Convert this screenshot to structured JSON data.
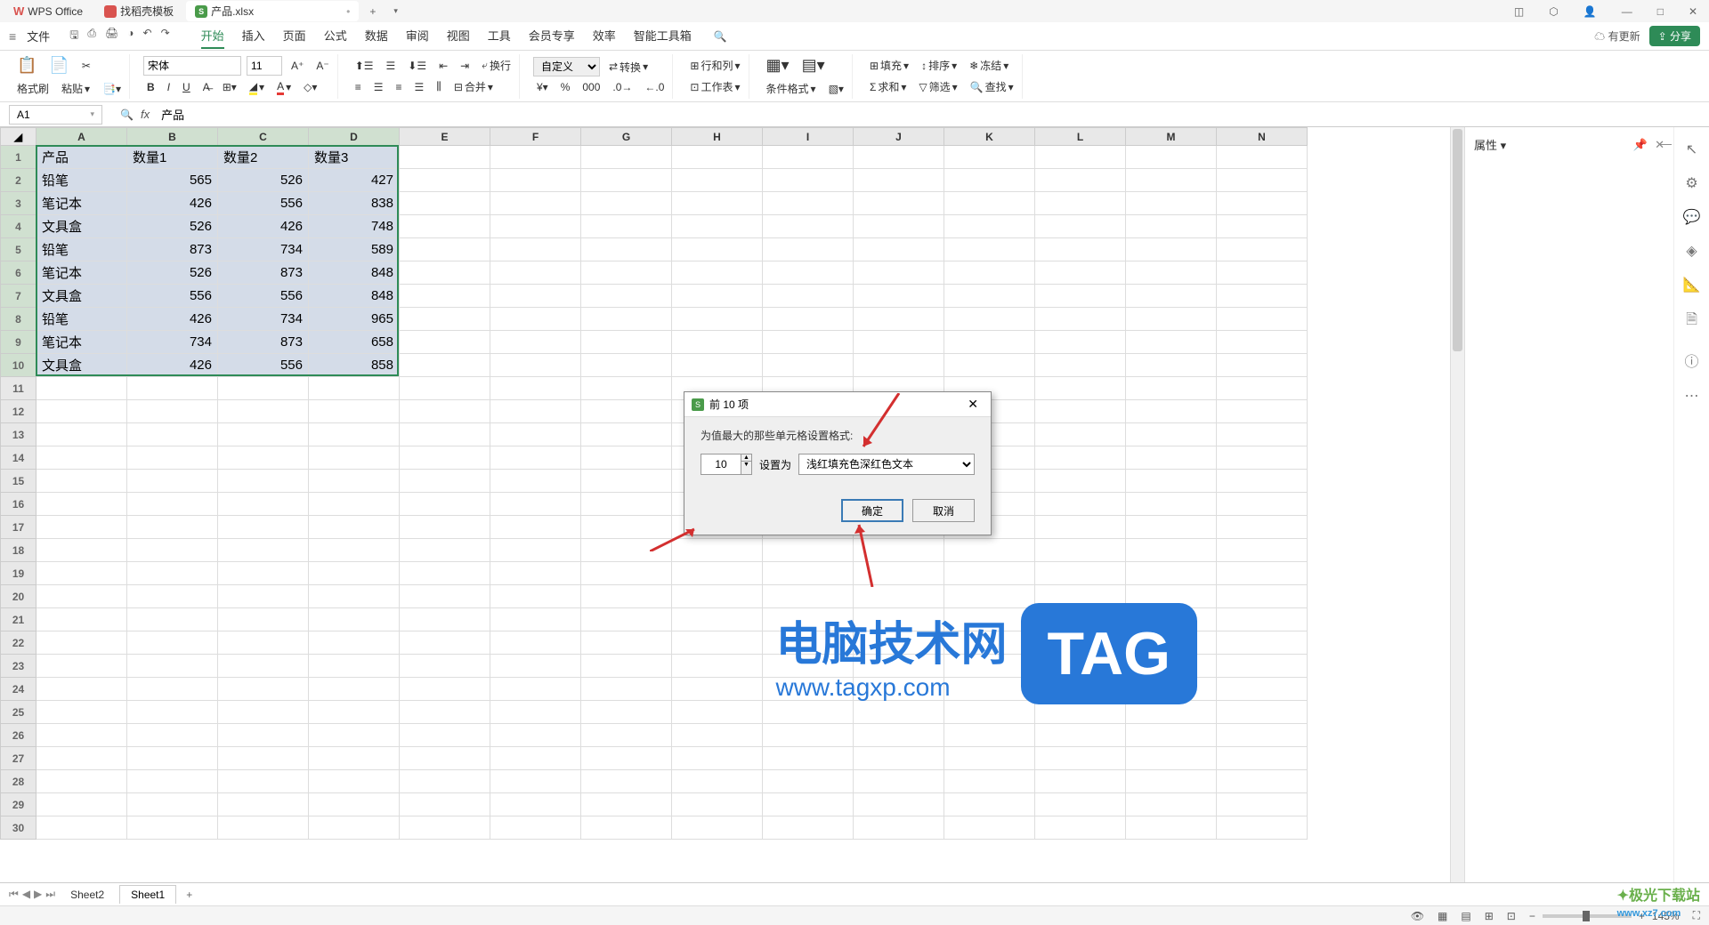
{
  "titlebar": {
    "app_name": "WPS Office",
    "tab_template": "找稻壳模板",
    "tab_file": "产品.xlsx"
  },
  "menubar": {
    "file": "文件",
    "tabs": [
      "开始",
      "插入",
      "页面",
      "公式",
      "数据",
      "审阅",
      "视图",
      "工具",
      "会员专享",
      "效率",
      "智能工具箱"
    ],
    "active_tab": "开始",
    "update": "有更新",
    "share": "分享"
  },
  "ribbon": {
    "format_painter": "格式刷",
    "paste": "粘贴",
    "font": "宋体",
    "font_size": "11",
    "wrap": "换行",
    "custom": "自定义",
    "convert": "转换",
    "rowcol": "行和列",
    "worksheet": "工作表",
    "cond_format": "条件格式",
    "merge": "合并",
    "fill": "填充",
    "sort": "排序",
    "freeze": "冻结",
    "sum": "求和",
    "filter": "筛选",
    "find": "查找"
  },
  "formulabar": {
    "cell_ref": "A1",
    "formula": "产品"
  },
  "columns": [
    "A",
    "B",
    "C",
    "D",
    "E",
    "F",
    "G",
    "H",
    "I",
    "J",
    "K",
    "L",
    "M",
    "N"
  ],
  "table": {
    "headers": [
      "产品",
      "数量1",
      "数量2",
      "数量3"
    ],
    "rows": [
      [
        "铅笔",
        "565",
        "526",
        "427"
      ],
      [
        "笔记本",
        "426",
        "556",
        "838"
      ],
      [
        "文具盒",
        "526",
        "426",
        "748"
      ],
      [
        "铅笔",
        "873",
        "734",
        "589"
      ],
      [
        "笔记本",
        "526",
        "873",
        "848"
      ],
      [
        "文具盒",
        "556",
        "556",
        "848"
      ],
      [
        "铅笔",
        "426",
        "734",
        "965"
      ],
      [
        "笔记本",
        "734",
        "873",
        "658"
      ],
      [
        "文具盒",
        "426",
        "556",
        "858"
      ]
    ]
  },
  "right_panel": {
    "title": "属性"
  },
  "dialog": {
    "title": "前 10 项",
    "label": "为值最大的那些单元格设置格式:",
    "spin_value": "10",
    "set_as": "设置为",
    "format_option": "浅红填充色深红色文本",
    "ok": "确定",
    "cancel": "取消"
  },
  "sheets": {
    "sheet2": "Sheet2",
    "sheet1": "Sheet1"
  },
  "statusbar": {
    "zoom": "145%"
  },
  "watermark": {
    "text": "电脑技术网",
    "url": "www.tagxp.com",
    "tag": "TAG"
  },
  "corner_logo": {
    "brand": "极光下载站",
    "url": "www.xz7.com"
  }
}
